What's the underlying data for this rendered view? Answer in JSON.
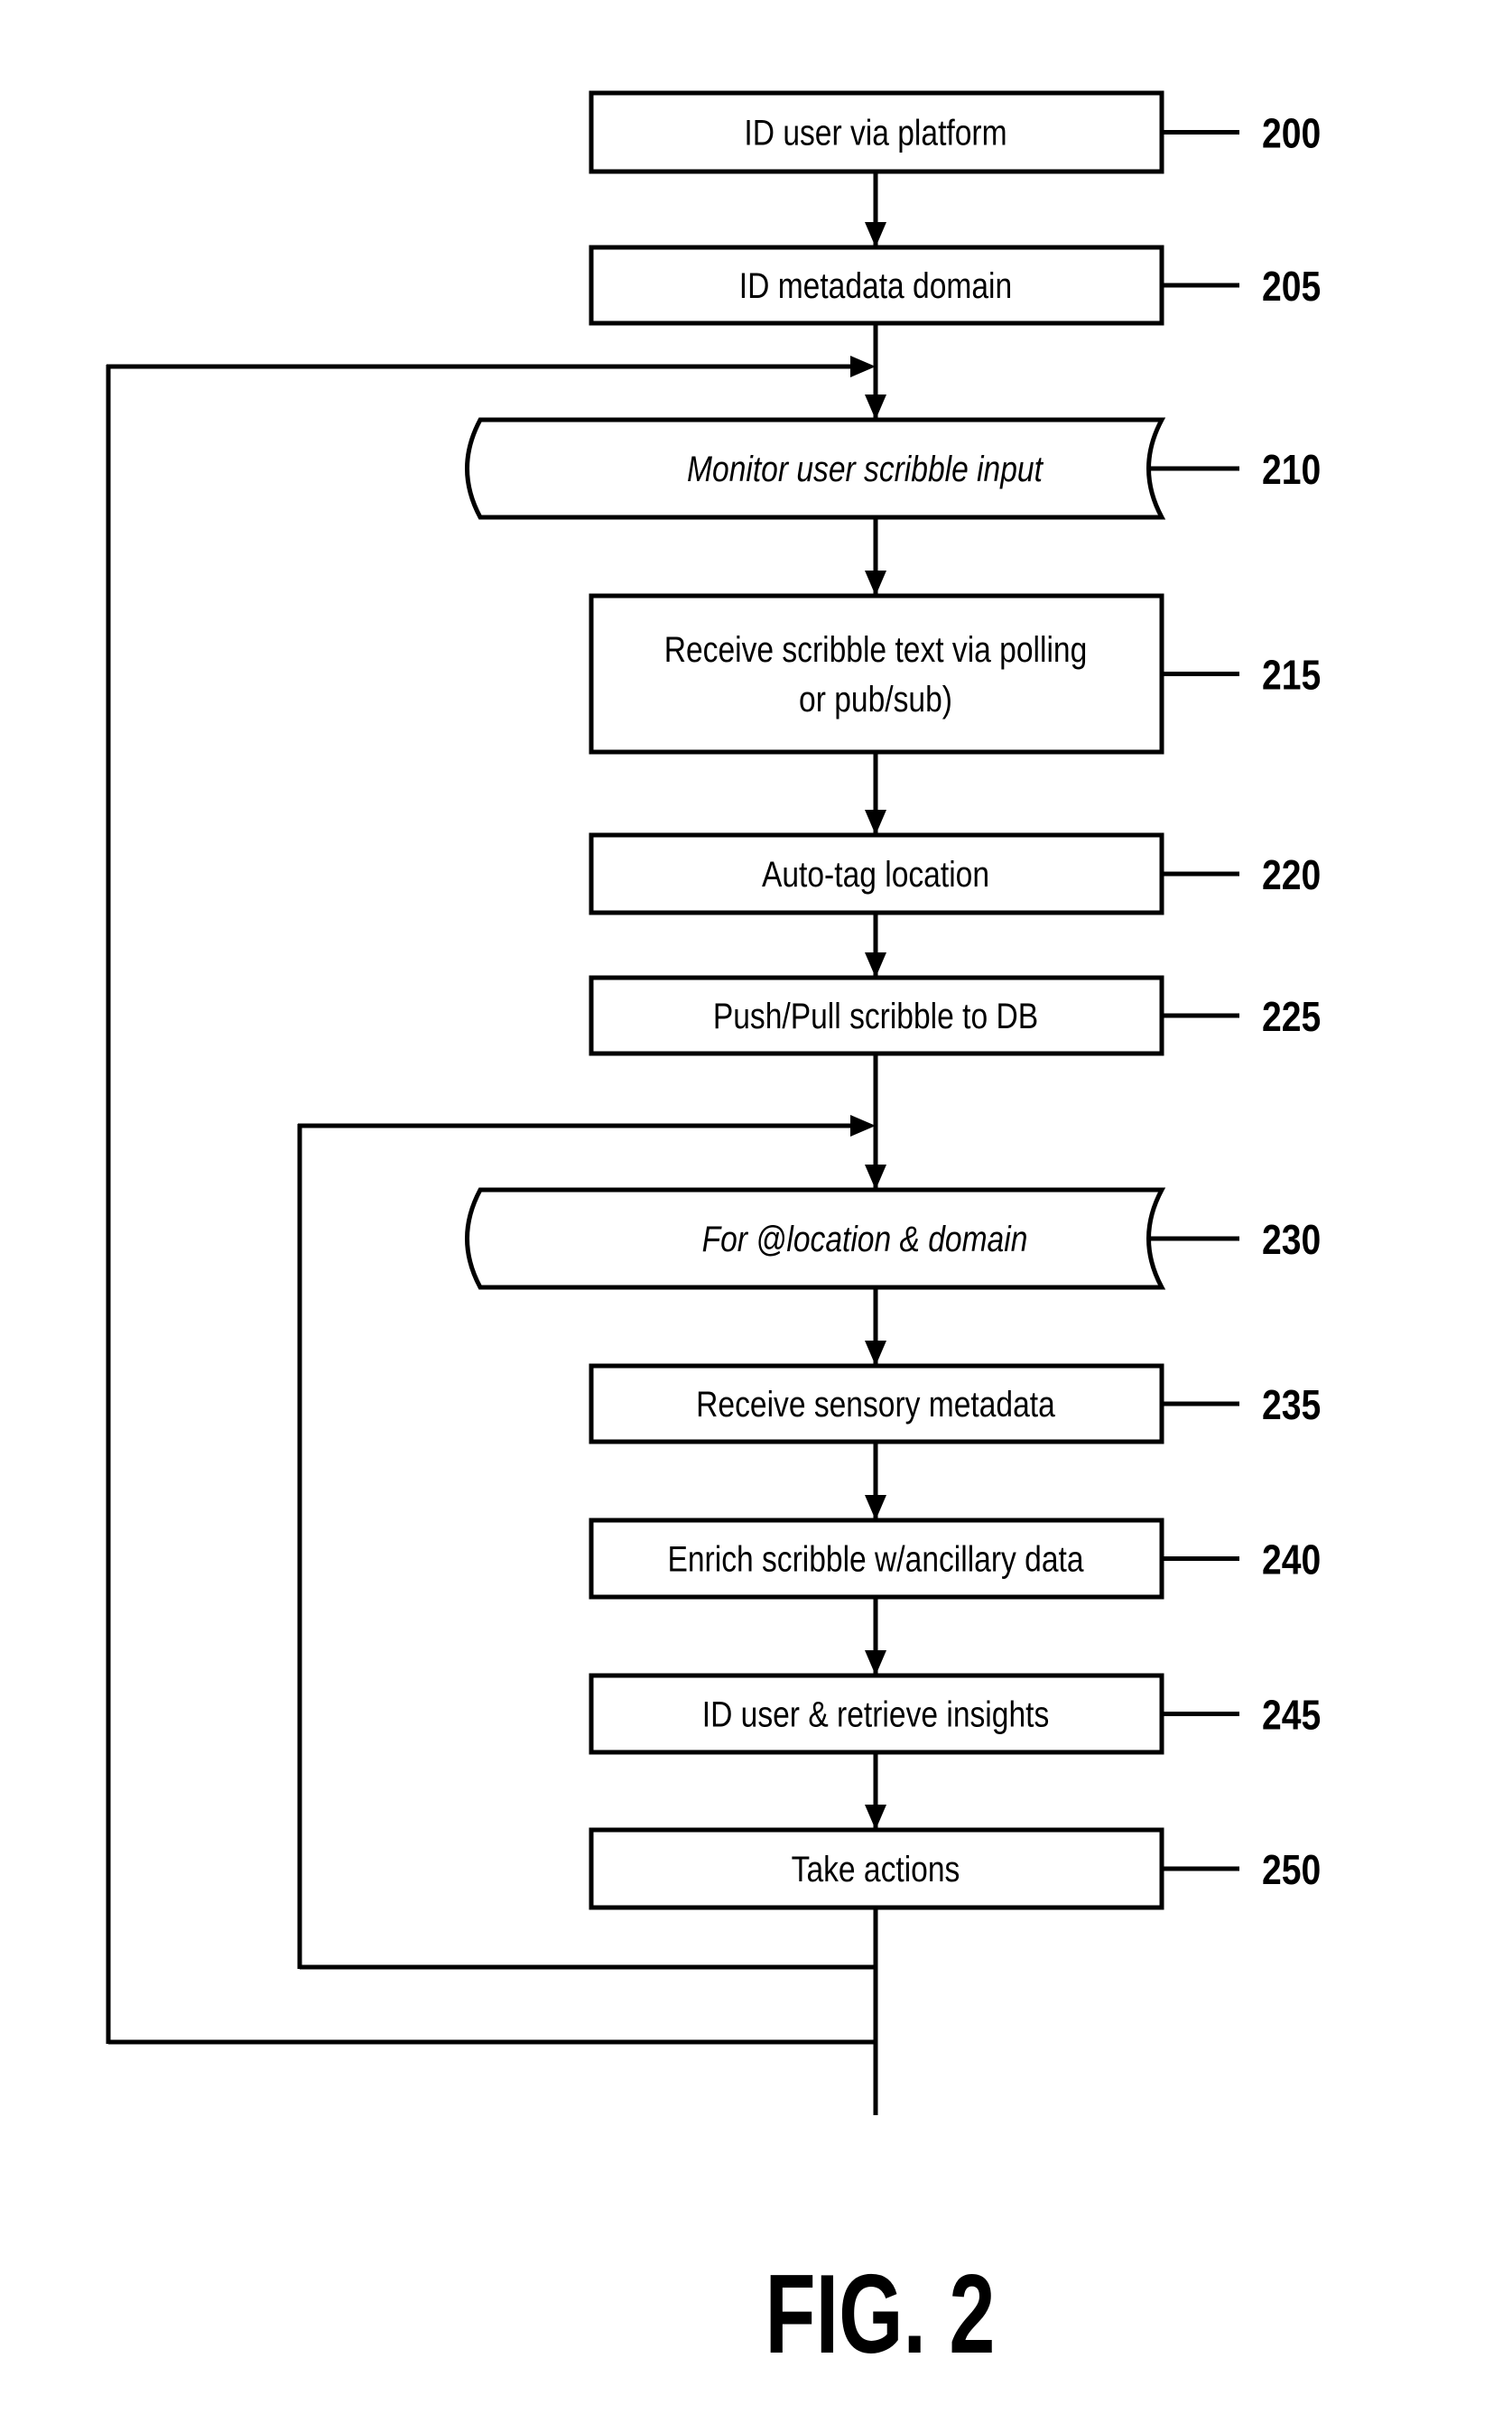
{
  "figure": {
    "label": "FIG. 2"
  },
  "steps": [
    {
      "id": "200",
      "text": [
        "ID user via platform"
      ],
      "shape": "process",
      "italic": false
    },
    {
      "id": "205",
      "text": [
        "ID metadata domain"
      ],
      "shape": "process",
      "italic": false
    },
    {
      "id": "210",
      "text": [
        "Monitor user scribble input"
      ],
      "shape": "loop-limit",
      "italic": true
    },
    {
      "id": "215",
      "text": [
        "Receive scribble text via polling",
        "or pub/sub)"
      ],
      "shape": "process",
      "italic": false
    },
    {
      "id": "220",
      "text": [
        "Auto-tag location"
      ],
      "shape": "process",
      "italic": false
    },
    {
      "id": "225",
      "text": [
        "Push/Pull scribble to DB"
      ],
      "shape": "process",
      "italic": false
    },
    {
      "id": "230",
      "text": [
        "For @location & domain"
      ],
      "shape": "loop-limit",
      "italic": true
    },
    {
      "id": "235",
      "text": [
        "Receive sensory metadata"
      ],
      "shape": "process",
      "italic": false
    },
    {
      "id": "240",
      "text": [
        "Enrich scribble w/ancillary data"
      ],
      "shape": "process",
      "italic": false
    },
    {
      "id": "245",
      "text": [
        "ID user & retrieve insights"
      ],
      "shape": "process",
      "italic": false
    },
    {
      "id": "250",
      "text": [
        "Take actions"
      ],
      "shape": "process",
      "italic": false
    }
  ],
  "loops": [
    {
      "name": "outer-loop",
      "from_step": "250",
      "to_step": "210"
    },
    {
      "name": "inner-loop",
      "from_step": "250",
      "to_step": "230"
    }
  ],
  "colors": {
    "stroke": "#000000",
    "background": "#ffffff"
  }
}
